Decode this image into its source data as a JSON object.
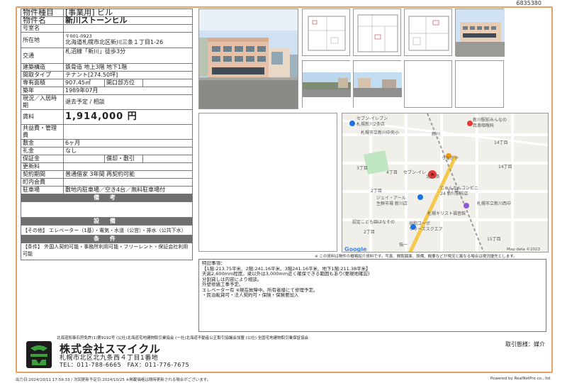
{
  "doc_id": "6835380",
  "spec": {
    "type_label": "物件種目",
    "type_value": "[事業用] ビル",
    "name_label": "物件名",
    "name_value": "新川ストーンヒル",
    "room_label": "号室名",
    "room_value": "",
    "loc_label": "所在地",
    "zip": "〒001-0923",
    "address": "北海道札幌市北区新川三条１丁目1-26",
    "traffic_label": "交通",
    "traffic_value": "札沼線「新川」徒歩3分",
    "structure_label": "建築構造",
    "structure_value": "鉄骨造 地上3階 地下1階",
    "layout_label": "間取タイプ",
    "layout_value": "テナント[274.50坪]",
    "area_label": "専有面積",
    "area_value": "907.45㎡",
    "direction_label": "開口部方位",
    "direction_value": "",
    "built_label": "築年",
    "built_value": "1989年07月",
    "status_label": "現況／入居時期",
    "status_value": "退去予定 / 相談",
    "rent_label": "賃料",
    "rent_value": "1,914,000 円",
    "fee_label": "共益費・管理費",
    "fee_value": "",
    "deposit_label": "敷金",
    "deposit_value": "6ヶ月",
    "key_label": "礼金",
    "key_value": "なし",
    "guarantee_label": "保証金",
    "guarantee_value": "",
    "amort_label": "償却・敷引",
    "amort_value": "",
    "renewal_label": "更新料",
    "renewal_value": "",
    "contract_label": "契約期間",
    "contract_value": "普通借家 3年間 再契約可能",
    "town_label": "町内会費",
    "town_value": "",
    "parking_label": "駐車場",
    "parking_value": "敷地内駐車場／空き4台／無料駐車場付",
    "biko_header": "備 考",
    "setsubi_header": "設 備",
    "setsubi_value": "【その他】 エレベーター（1基）・電気・水道（公営）・排水（公共下水）",
    "joken_header": "条 件",
    "joken_value": "【条件】 外国人契約可能・事務所利用可能・フリーレント・保証会社利用可能"
  },
  "map": {
    "labels": [
      "セブン-イレブン",
      "札幌新川2条店",
      "札幌市立新川中央小",
      "新川",
      "新川駅前みんなの",
      "耳鼻咽喉科",
      "うなぎや",
      "3丁目",
      "4丁目",
      "14丁目",
      "14丁目",
      "3丁目",
      "2丁目",
      "じゅんかんコンビニ",
      "24 新川駅前店",
      "ジェイ・アール",
      "生鮮市場 新川店",
      "札幌市立新川西中",
      "札幌キリスト福音館",
      "認定こども園はなその",
      "共和コーポ",
      "リリーズスクエア",
      "2丁目",
      "15丁目",
      "強一",
      "セブン-イレ",
      "北24条"
    ],
    "credit": "Map data ©2023",
    "google": "Google"
  },
  "map_note": "※ この資料は物件の概略紹介資料です。写真、間取図面、設備、概要などが現況と異なる場合は現況優先とします。",
  "remarks": {
    "title": "特記事項：",
    "lines": [
      "【1階:213.75平米、2階:241.16平米、3階241.16平米、地下1階:211.38平米】",
      "天高2,600mm程度。梁以外は3,000mm近く確保できる範囲もあり(要現地確認)",
      "分割貸しは内容により相談。",
      "外壁修繕工事予定。",
      "エレベーター有 ※現在故障中。所有者様にて修理予定。",
      "・民泊転貸可・法人契約可・保険・保険要加入"
    ]
  },
  "footer": {
    "assoc": "北海道知事石狩免許(1)第9192号 (公社)北海道宅地建物取引業協会 (一社)北海道不動産公正取引協議会加盟 (公社) 全国宅地建物取引業保証協会",
    "company": "株式会社スマイクル",
    "address": "札幌市北区北九条西４丁目1番地",
    "tel": "TEL：011-788-6665　FAX：011-776-7675",
    "deal": "取引態様：媒介",
    "printed": "出力日:2024/10/11 17:59:33 / 次回更新予定日:2024/10/25 ※掲載価格は随時更新される場合がございます。",
    "powered": "Powered by RealNetPro co., ltd."
  },
  "colors": {
    "frame": "#e8a060",
    "section": "#6e6e6e",
    "logo_green": "#3aa03a",
    "logo_dark": "#1c1c1c"
  }
}
